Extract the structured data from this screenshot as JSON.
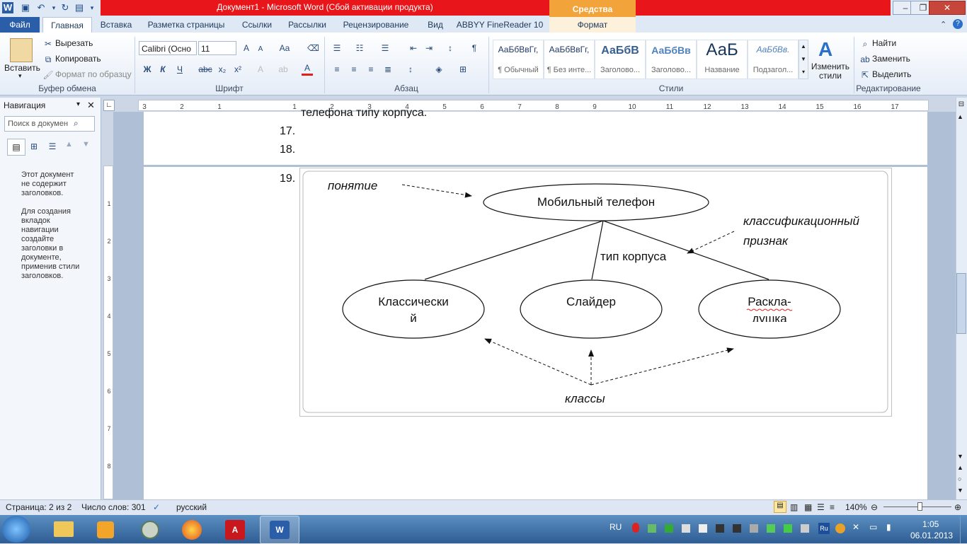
{
  "window": {
    "title": "Документ1  -  Microsoft Word (Сбой активации продукта)",
    "context_tab": "Средства рисования"
  },
  "tabs": [
    "Файл",
    "Главная",
    "Вставка",
    "Разметка страницы",
    "Ссылки",
    "Рассылки",
    "Рецензирование",
    "Вид",
    "ABBYY FineReader 10",
    "Формат"
  ],
  "ribbon": {
    "clipboard": {
      "paste": "Вставить",
      "cut": "Вырезать",
      "copy": "Копировать",
      "format_painter": "Формат по образцу",
      "label": "Буфер обмена"
    },
    "font": {
      "name": "Calibri (Осно",
      "size": "11",
      "label": "Шрифт",
      "bold": "Ж",
      "italic": "К",
      "underline": "Ч",
      "strike": "abc",
      "sub": "x₂",
      "sup": "x²"
    },
    "paragraph": {
      "label": "Абзац"
    },
    "styles": {
      "label": "Стили",
      "items": [
        {
          "sample": "АаБбВвГг,",
          "name": "¶ Обычный"
        },
        {
          "sample": "АаБбВвГг,",
          "name": "¶ Без инте..."
        },
        {
          "sample": "АаБбВ",
          "name": "Заголово..."
        },
        {
          "sample": "АаБбВв",
          "name": "Заголово..."
        },
        {
          "sample": "АаБ",
          "name": "Название"
        },
        {
          "sample": "АаБбВв.",
          "name": "Подзагол..."
        }
      ],
      "change": "Изменить стили"
    },
    "editing": {
      "find": "Найти",
      "replace": "Заменить",
      "select": "Выделить",
      "label": "Редактирование"
    }
  },
  "nav": {
    "title": "Навигация",
    "search_placeholder": "Поиск в докумен",
    "msg1": "Этот документ не содержит заголовков.",
    "msg2": "Для создания вкладок навигации создайте заголовки в документе, применив стили заголовков."
  },
  "ruler": {
    "h_ticks": [
      "3",
      "2",
      "1",
      "1",
      "2",
      "3",
      "4",
      "5",
      "6",
      "7",
      "8",
      "9",
      "10",
      "11",
      "12",
      "13",
      "14",
      "15",
      "16",
      "17"
    ],
    "v_ticks": [
      "1",
      "2",
      "3",
      "4",
      "5",
      "6",
      "7",
      "8"
    ]
  },
  "document": {
    "partial_line": "телефона типу корпуса.",
    "items": [
      "17.",
      "18.",
      "19."
    ]
  },
  "diagram": {
    "concept_label": "понятие",
    "root": "Мобильный телефон",
    "classif_label_1": "классификационный",
    "classif_label_2": "признак",
    "edge_label": "тип корпуса",
    "child1_a": "Классически",
    "child1_b": "й",
    "child2": "Слайдер",
    "child3_a": "Раскла-",
    "child3_b": "душка",
    "classes_label": "классы"
  },
  "status": {
    "page": "Страница: 2 из 2",
    "words": "Число слов: 301",
    "lang": "русский",
    "zoom": "140%"
  },
  "taskbar": {
    "lang": "RU",
    "time": "1:05",
    "date": "06.01.2013"
  },
  "colors": {
    "accent": "#2a5ea8",
    "title_red": "#e8161a",
    "context_orange": "#f2a43a"
  }
}
